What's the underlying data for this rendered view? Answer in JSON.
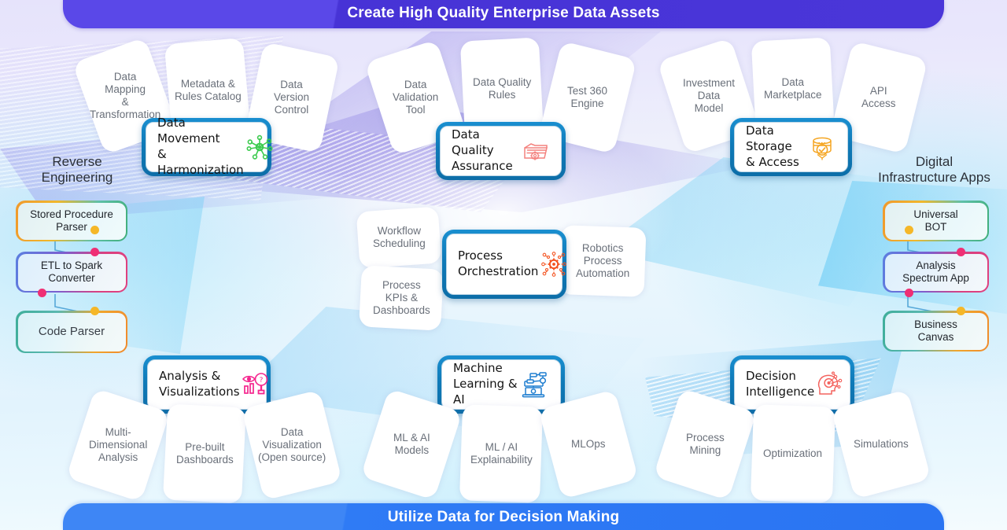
{
  "banners": {
    "top": "Create High Quality Enterprise Data Assets",
    "bottom": "Utilize Data for Decision Making"
  },
  "colors": {
    "banner_top": "#4a36d9",
    "banner_bottom": "#2f7bf5",
    "card_border": "#0f7ab8",
    "icon_green": "#3dcb4f",
    "icon_red": "#f4635e",
    "icon_orange": "#f5a623",
    "icon_pink": "#f5258e",
    "icon_blue": "#1f7ed0",
    "icon_orange_red": "#f4521f"
  },
  "main_cards": [
    {
      "id": "data-movement-harmonization",
      "label": "Data\nMovement\n& Harmonization",
      "icon": "network-hub-icon",
      "icon_color": "#3dcb4f"
    },
    {
      "id": "data-quality-assurance",
      "label": "Data Quality\nAssurance",
      "icon": "folder-gear-icon",
      "icon_color": "#f4827e"
    },
    {
      "id": "data-storage-access",
      "label": "Data Storage\n& Access",
      "icon": "database-check-icon",
      "icon_color": "#f5a623"
    },
    {
      "id": "process-orchestration",
      "label": "Process\nOrchestration",
      "icon": "gear-circuit-icon",
      "icon_color": "#f4521f"
    },
    {
      "id": "analysis-visualizations",
      "label": "Analysis &\nVisualizations",
      "icon": "eye-magnifier-chart-icon",
      "icon_color": "#f5258e"
    },
    {
      "id": "machine-learning-ai",
      "label": "Machine\nLearning & AI",
      "icon": "laptop-flow-icon",
      "icon_color": "#1f7ed0"
    },
    {
      "id": "decision-intelligence",
      "label": "Decision\nIntelligence",
      "icon": "head-target-icon",
      "icon_color": "#f4635e"
    }
  ],
  "petals": {
    "data_movement": [
      "Data\nMapping\n&\nTransformation",
      "Metadata &\nRules Catalog",
      "Data\nVersion\nControl"
    ],
    "data_quality": [
      "Data\nValidation\nTool",
      "Data Quality\nRules",
      "Test 360\nEngine"
    ],
    "data_storage": [
      "Investment\nData\nModel",
      "Data\nMarketplace",
      "API\nAccess"
    ],
    "process_orchestration": [
      "Workflow\nScheduling",
      "Process\nKPIs &\nDashboards",
      "Robotics\nProcess\nAutomation"
    ],
    "analysis_visualizations": [
      "Multi-\nDimensional\nAnalysis",
      "Pre-built\nDashboards",
      "Data\nVisualization\n(Open source)"
    ],
    "machine_learning": [
      "ML & AI\nModels",
      "ML / AI\nExplainability",
      "MLOps"
    ],
    "decision_intelligence": [
      "Process\nMining",
      "Optimization",
      "Simulations"
    ]
  },
  "left_panel": {
    "title": "Reverse\nEngineering",
    "items": [
      {
        "label": "Stored Procedure\nParser",
        "style": "a"
      },
      {
        "label": "ETL to Spark\nConverter",
        "style": "b"
      },
      {
        "label": "Code Parser",
        "style": "c"
      }
    ]
  },
  "right_panel": {
    "title": "Digital\nInfrastructure Apps",
    "items": [
      {
        "label": "Universal\nBOT",
        "style": "a"
      },
      {
        "label": "Analysis\nSpectrum App",
        "style": "b"
      },
      {
        "label": "Business\nCanvas",
        "style": "c"
      }
    ]
  }
}
